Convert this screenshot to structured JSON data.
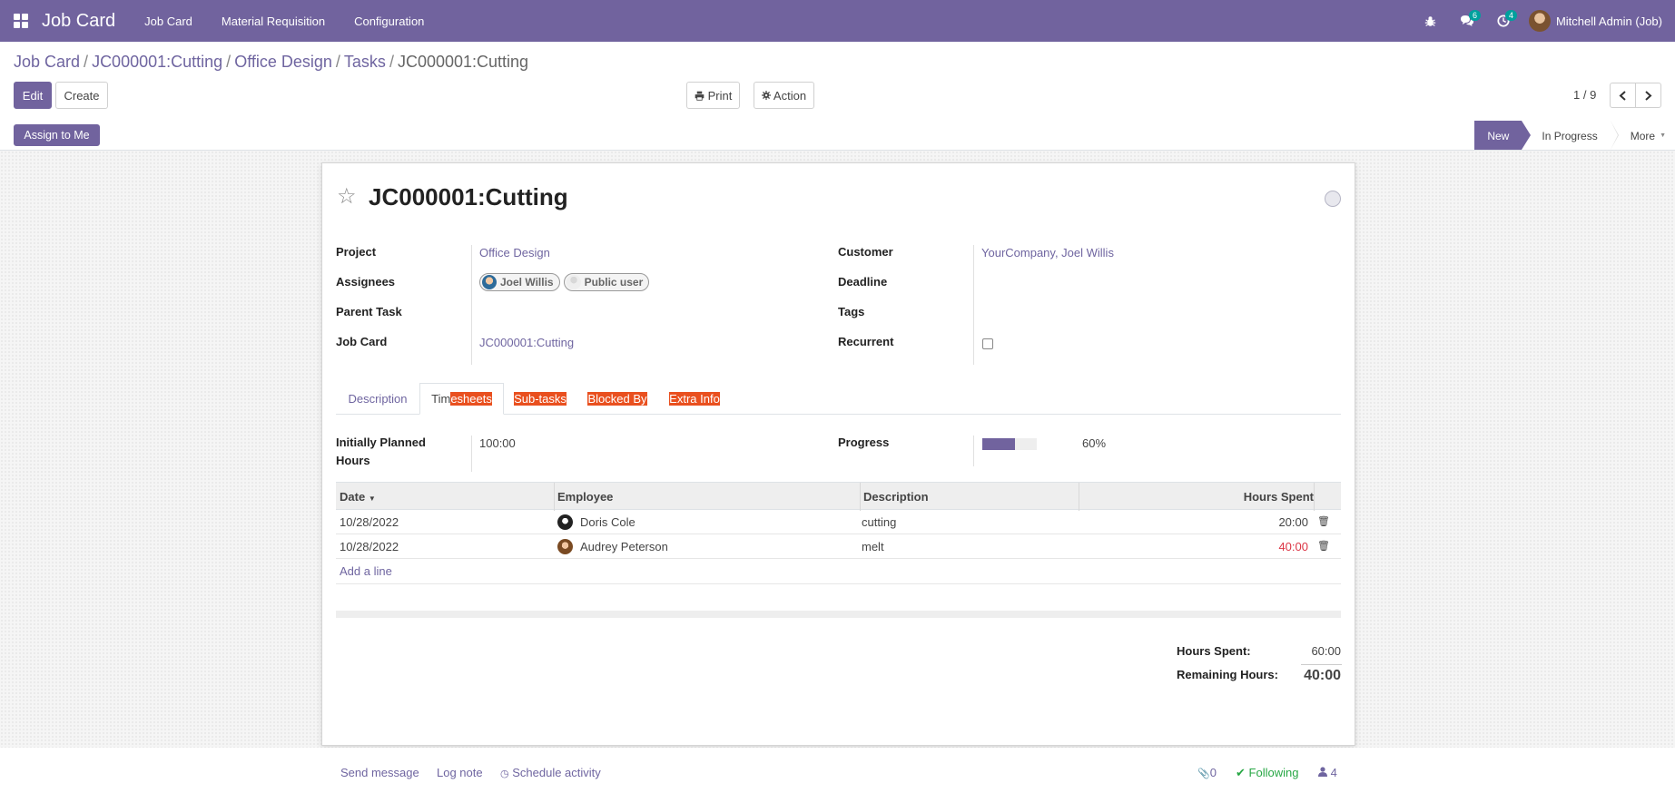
{
  "navbar": {
    "app_title": "Job Card",
    "menu": [
      "Job Card",
      "Material Requisition",
      "Configuration"
    ],
    "messages_count": "6",
    "activities_count": "4",
    "user_name": "Mitchell Admin (Job)"
  },
  "breadcrumb": [
    "Job Card",
    "JC000001:Cutting",
    "Office Design",
    "Tasks"
  ],
  "breadcrumb_current": "JC000001:Cutting",
  "buttons": {
    "edit": "Edit",
    "create": "Create",
    "print": "Print",
    "action": "Action",
    "assign_to_me": "Assign to Me"
  },
  "pager": "1 / 9",
  "stages": {
    "current": "New",
    "next": "In Progress",
    "more": "More"
  },
  "task": {
    "title": "JC000001:Cutting",
    "labels": {
      "project": "Project",
      "assignees": "Assignees",
      "parent_task": "Parent Task",
      "job_card": "Job Card",
      "customer": "Customer",
      "deadline": "Deadline",
      "tags": "Tags",
      "recurrent": "Recurrent"
    },
    "project": "Office Design",
    "assignees": [
      "Joel Willis",
      "Public user"
    ],
    "job_card": "JC000001:Cutting",
    "customer": "YourCompany, Joel Willis",
    "recurrent": false
  },
  "tabs": {
    "description": "Description",
    "timesheets_a": "Tim",
    "timesheets_b": "esheets",
    "subtasks": "Sub-tasks",
    "blocked_by": "Blocked By",
    "extra_info": "Extra Info"
  },
  "planning": {
    "planned_label_1": "Initially Planned",
    "planned_label_2": "Hours",
    "planned_value": "100:00",
    "progress_label": "Progress",
    "progress_value": "60%",
    "progress_fraction": 0.6
  },
  "timesheet": {
    "headers": {
      "date": "Date",
      "employee": "Employee",
      "description": "Description",
      "hours": "Hours Spent"
    },
    "rows": [
      {
        "date": "10/28/2022",
        "employee": "Doris Cole",
        "description": "cutting",
        "hours": "20:00",
        "overtime": false
      },
      {
        "date": "10/28/2022",
        "employee": "Audrey Peterson",
        "description": "melt",
        "hours": "40:00",
        "overtime": true
      }
    ],
    "add_line": "Add a line"
  },
  "totals": {
    "hours_spent_label": "Hours Spent:",
    "hours_spent_value": "60:00",
    "remaining_label": "Remaining Hours:",
    "remaining_value": "40:00"
  },
  "chatter": {
    "send_message": "Send message",
    "log_note": "Log note",
    "schedule_activity": "Schedule activity",
    "attachments": "0",
    "following": "Following",
    "followers": "4"
  },
  "colors": {
    "brand": "#71639e",
    "highlight": "#e9501f",
    "danger": "#dc3545",
    "success": "#28a745"
  },
  "icons": [
    "apps-icon",
    "bug-icon",
    "chat-icon",
    "clock-icon",
    "print-icon",
    "gear-icon",
    "chevron-left-icon",
    "chevron-right-icon",
    "star-icon",
    "trash-icon",
    "paperclip-icon",
    "check-icon",
    "user-icon"
  ]
}
